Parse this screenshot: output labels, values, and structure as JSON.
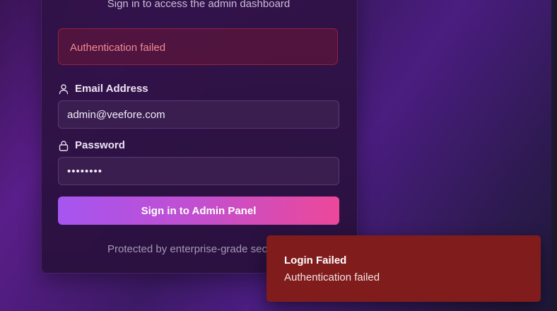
{
  "login": {
    "subtitle": "Sign in to access the admin dashboard",
    "error_message": "Authentication failed",
    "email": {
      "label": "Email Address",
      "icon": "user-icon",
      "value": "admin@veefore.com"
    },
    "password": {
      "label": "Password",
      "icon": "lock-icon",
      "value": "••••••••"
    },
    "submit_label": "Sign in to Admin Panel",
    "footer": "Protected by enterprise-grade sec"
  },
  "toast": {
    "title": "Login Failed",
    "message": "Authentication failed"
  },
  "colors": {
    "error_box_text": "#f08a92",
    "button_gradient_start": "#a655f0",
    "button_gradient_end": "#ec4899",
    "toast_bg": "#811c1c"
  }
}
